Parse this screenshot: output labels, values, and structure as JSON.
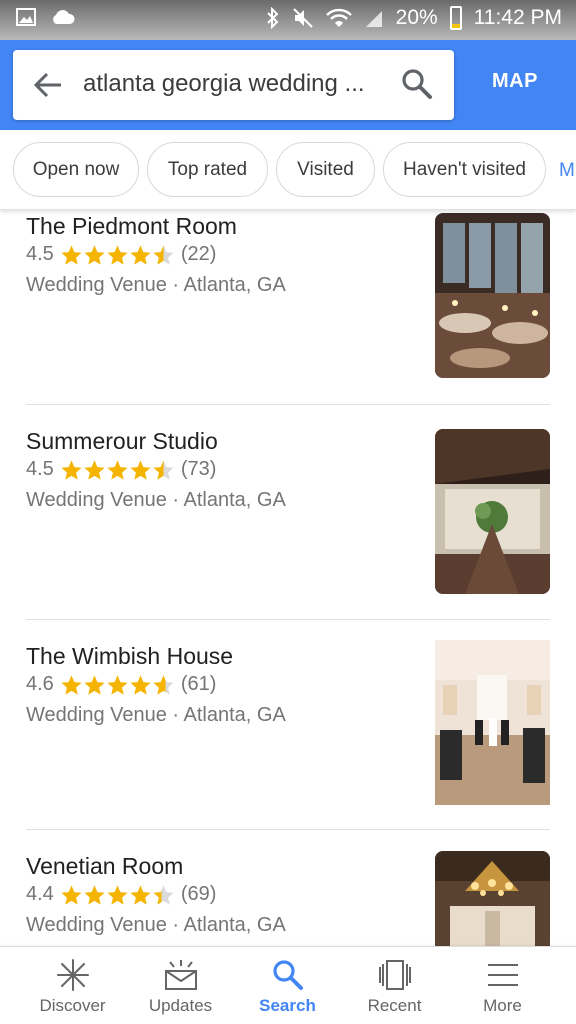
{
  "status_bar": {
    "battery": "20%",
    "time": "11:42 PM",
    "battery_level": 0.2
  },
  "search": {
    "query": "atlanta georgia wedding ...",
    "map_label": "MAP"
  },
  "chips": [
    "Open now",
    "Top rated",
    "Visited",
    "Haven't visited",
    "M"
  ],
  "results": [
    {
      "name": "The Piedmont Room",
      "rating": "4.5",
      "stars": 4.5,
      "reviews": "(22)",
      "meta": "Wedding Venue · Atlanta, GA"
    },
    {
      "name": "Summerour Studio",
      "rating": "4.5",
      "stars": 4.5,
      "reviews": "(73)",
      "meta": "Wedding Venue · Atlanta, GA"
    },
    {
      "name": "The Wimbish House",
      "rating": "4.6",
      "stars": 4.6,
      "reviews": "(61)",
      "meta": "Wedding Venue · Atlanta, GA"
    },
    {
      "name": "Venetian Room",
      "rating": "4.4",
      "stars": 4.4,
      "reviews": "(69)",
      "meta": "Wedding Venue · Atlanta, GA"
    }
  ],
  "nav": [
    {
      "label": "Discover",
      "icon": "discover-icon"
    },
    {
      "label": "Updates",
      "icon": "updates-icon"
    },
    {
      "label": "Search",
      "icon": "search-icon"
    },
    {
      "label": "Recent",
      "icon": "recent-icon"
    },
    {
      "label": "More",
      "icon": "more-icon"
    }
  ],
  "colors": {
    "brand_blue": "#4285f4",
    "star": "#f4b400",
    "text_primary": "#212121",
    "text_secondary": "#757575"
  }
}
